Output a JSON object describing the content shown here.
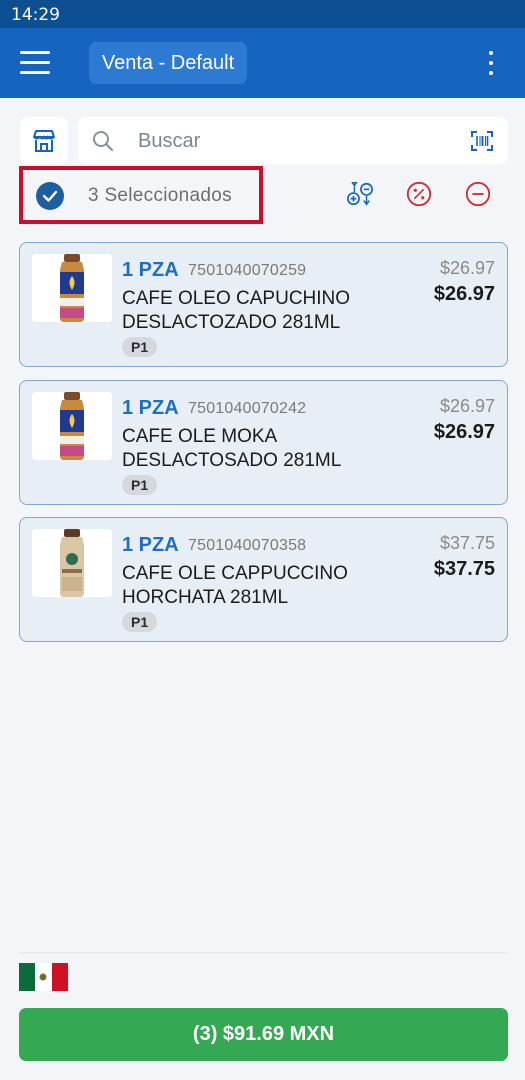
{
  "status_bar": {
    "time": "14:29"
  },
  "app_bar": {
    "title": "Venta - Default"
  },
  "search": {
    "placeholder": "Buscar"
  },
  "selection": {
    "label": "3 Seleccionados"
  },
  "products": [
    {
      "qty": "1 PZA",
      "barcode": "7501040070259",
      "name_line1": "CAFE OLEO CAPUCHINO",
      "name_line2": "DESLACTOZADO 281ML",
      "badge": "P1",
      "price_original": "$26.97",
      "price": "$26.97"
    },
    {
      "qty": "1 PZA",
      "barcode": "7501040070242",
      "name_line1": "CAFE OLE MOKA",
      "name_line2": "DESLACTOSADO 281ML",
      "badge": "P1",
      "price_original": "$26.97",
      "price": "$26.97"
    },
    {
      "qty": "1 PZA",
      "barcode": "7501040070358",
      "name_line1": "CAFE OLE CAPPUCCINO",
      "name_line2": "HORCHATA 281ML",
      "badge": "P1",
      "price_original": "$37.75",
      "price": "$37.75"
    }
  ],
  "footer": {
    "total_label": "(3) $91.69 MXN",
    "flag": "mexico-flag"
  },
  "colors": {
    "app_bar": "#1565c0",
    "status_bar": "#0d4f93",
    "accent_blue": "#1f6fbf",
    "danger_red": "#d32f2f",
    "selection_outline": "#c8102e",
    "total_button": "#34a853"
  }
}
